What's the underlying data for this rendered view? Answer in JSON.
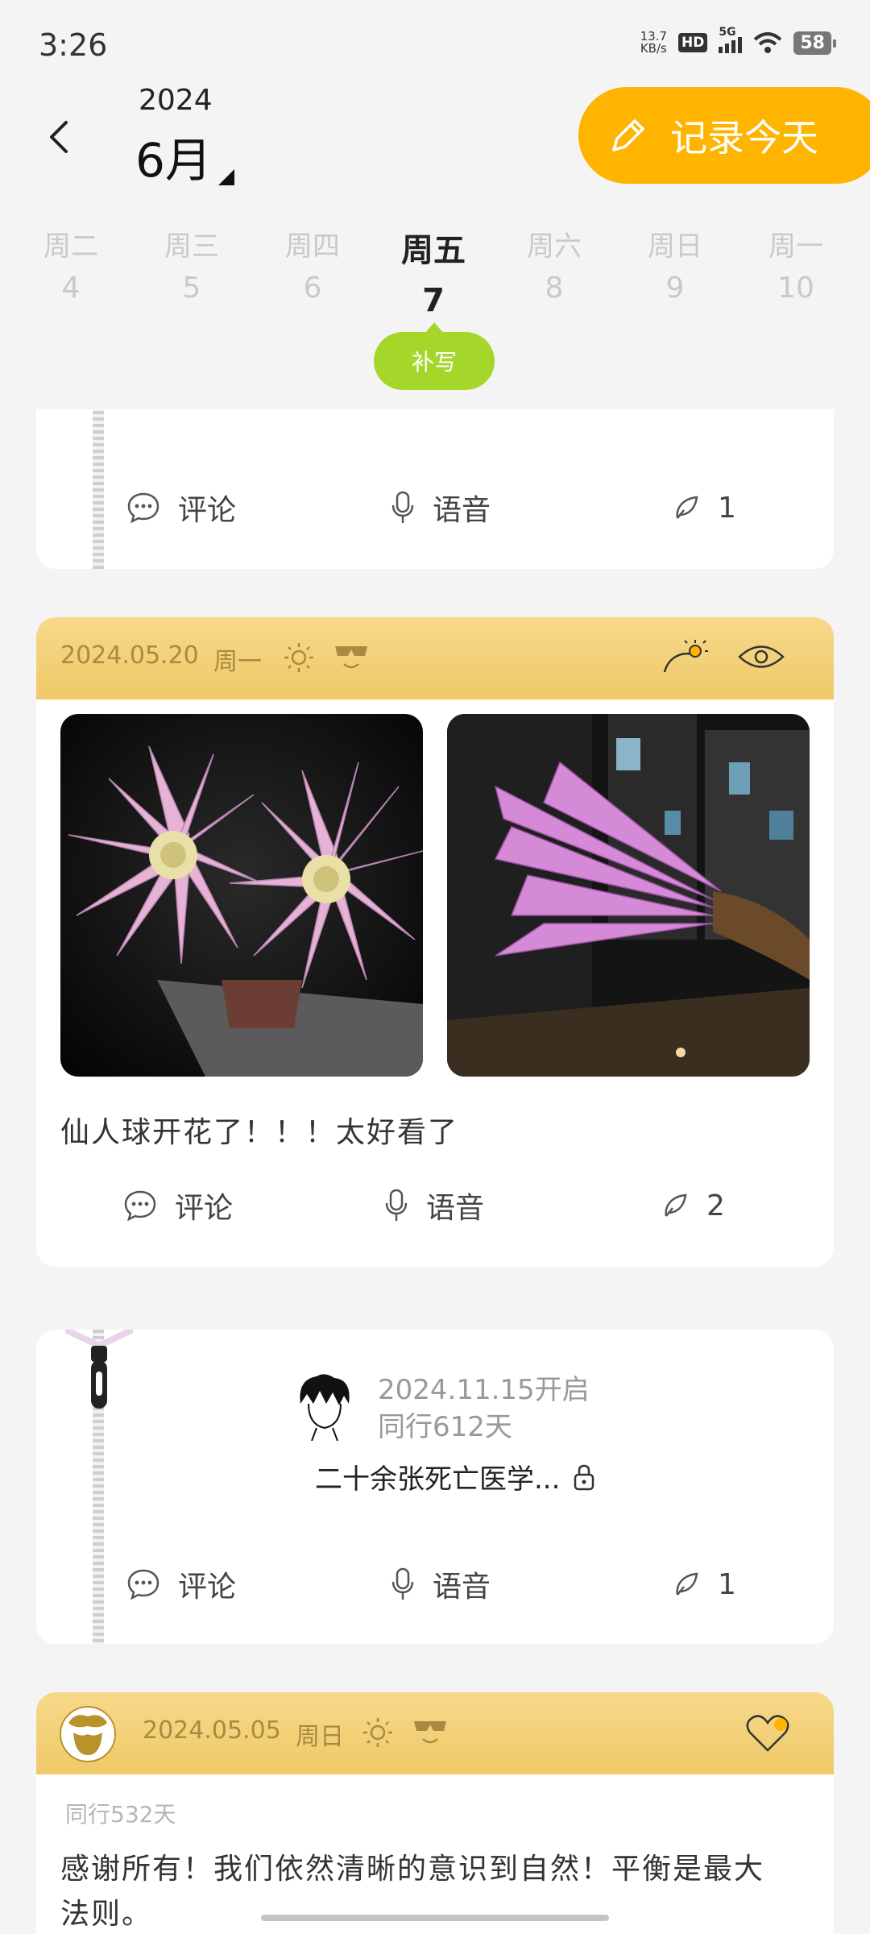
{
  "status": {
    "time": "3:26",
    "net_speed_top": "13.7",
    "net_speed_bottom": "KB/s",
    "hd": "HD",
    "signal": "5G",
    "battery": "58"
  },
  "header": {
    "year": "2024",
    "month": "6月",
    "record_button": "记录今天"
  },
  "week": [
    {
      "dow": "周二",
      "day": "4"
    },
    {
      "dow": "周三",
      "day": "5"
    },
    {
      "dow": "周四",
      "day": "6"
    },
    {
      "dow": "周五",
      "day": "7",
      "active": true
    },
    {
      "dow": "周六",
      "day": "8"
    },
    {
      "dow": "周日",
      "day": "9"
    },
    {
      "dow": "周一",
      "day": "10"
    }
  ],
  "supplement_button": "补写",
  "actions": {
    "comment": "评论",
    "voice": "语音"
  },
  "cards": [
    {
      "type": "partial",
      "reply_count": "1"
    },
    {
      "type": "diary",
      "date": "2024.05.20",
      "weekday": "周一",
      "text": "仙人球开花了！！！太好看了",
      "reply_count": "2"
    },
    {
      "type": "capsule",
      "opened": "2024.11.15开启",
      "companion": "同行612天",
      "title": "二十余张死亡医学...",
      "reply_count": "1"
    },
    {
      "type": "diary",
      "date": "2024.05.05",
      "weekday": "周日",
      "companion": "同行532天",
      "text": "感谢所有！我们依然清晰的意识到自然！平衡是最大法则。"
    }
  ],
  "colors": {
    "accent": "#ffb400",
    "supplement": "#a5d62a",
    "card_header": "#f4d27a"
  }
}
